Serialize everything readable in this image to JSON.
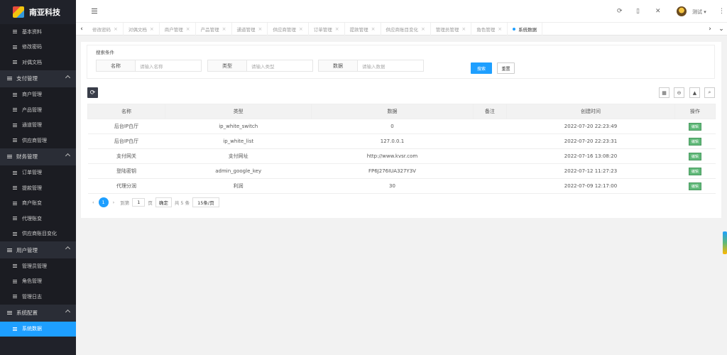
{
  "app": {
    "name": "南亚科技"
  },
  "sidebar": {
    "top_items": [
      "基本资料",
      "修改密码",
      "对偶文档"
    ],
    "groups": [
      {
        "title": "支付管理",
        "items": [
          "商户管理",
          "产品管理",
          "通道管理",
          "供应商管理"
        ]
      },
      {
        "title": "财务管理",
        "items": [
          "订单管理",
          "提款管理",
          "商户账变",
          "代理账变",
          "供应商账目变化"
        ]
      },
      {
        "title": "用户管理",
        "items": [
          "管理员管理",
          "角色管理",
          "管理日志"
        ]
      },
      {
        "title": "系统配置",
        "items": [
          "系统数据"
        ]
      }
    ]
  },
  "topbar": {
    "user": "测试 ▾"
  },
  "tabs": [
    {
      "label": "修改密码"
    },
    {
      "label": "对偶文档"
    },
    {
      "label": "商户管理"
    },
    {
      "label": "产品管理"
    },
    {
      "label": "通道管理"
    },
    {
      "label": "供应商管理"
    },
    {
      "label": "订单管理"
    },
    {
      "label": "提款管理"
    },
    {
      "label": "供应商账目变化"
    },
    {
      "label": "管理员管理"
    },
    {
      "label": "角色管理"
    },
    {
      "label": "系统数据"
    }
  ],
  "search": {
    "legend": "搜索条件",
    "fields": [
      {
        "label": "名称",
        "placeholder": "请输入名称"
      },
      {
        "label": "类型",
        "placeholder": "请输入类型"
      },
      {
        "label": "数据",
        "placeholder": "请输入数据"
      }
    ],
    "search_btn": "搜索",
    "reset_btn": "重置"
  },
  "table": {
    "headers": [
      "名称",
      "类型",
      "数据",
      "备注",
      "创建时间",
      "操作"
    ],
    "rows": [
      {
        "name": "后台IP白厅",
        "type": "ip_white_switch",
        "data": "0",
        "note": "",
        "created": "2022-07-20 22:23:49",
        "action": "编辑"
      },
      {
        "name": "后台IP白厅",
        "type": "ip_white_list",
        "data": "127.0.0.1",
        "note": "",
        "created": "2022-07-20 22:23:31",
        "action": "编辑"
      },
      {
        "name": "支付网关",
        "type": "支付网址",
        "data": "http://www.kvsr.com",
        "note": "",
        "created": "2022-07-16 13:08:20",
        "action": "编辑"
      },
      {
        "name": "登陆密钥",
        "type": "admin_google_key",
        "data": "FP6J276IUA327Y3V",
        "note": "",
        "created": "2022-07-12 11:27:23",
        "action": "编辑"
      },
      {
        "name": "代理分润",
        "type": "利润",
        "data": "30",
        "note": "",
        "created": "2022-07-09 12:17:00",
        "action": "编辑"
      }
    ]
  },
  "pager": {
    "current": "1",
    "goto": "到第",
    "page_input": "1",
    "page_unit": "页",
    "confirm": "确定",
    "total": "共 5 条",
    "size": "15条/页"
  }
}
